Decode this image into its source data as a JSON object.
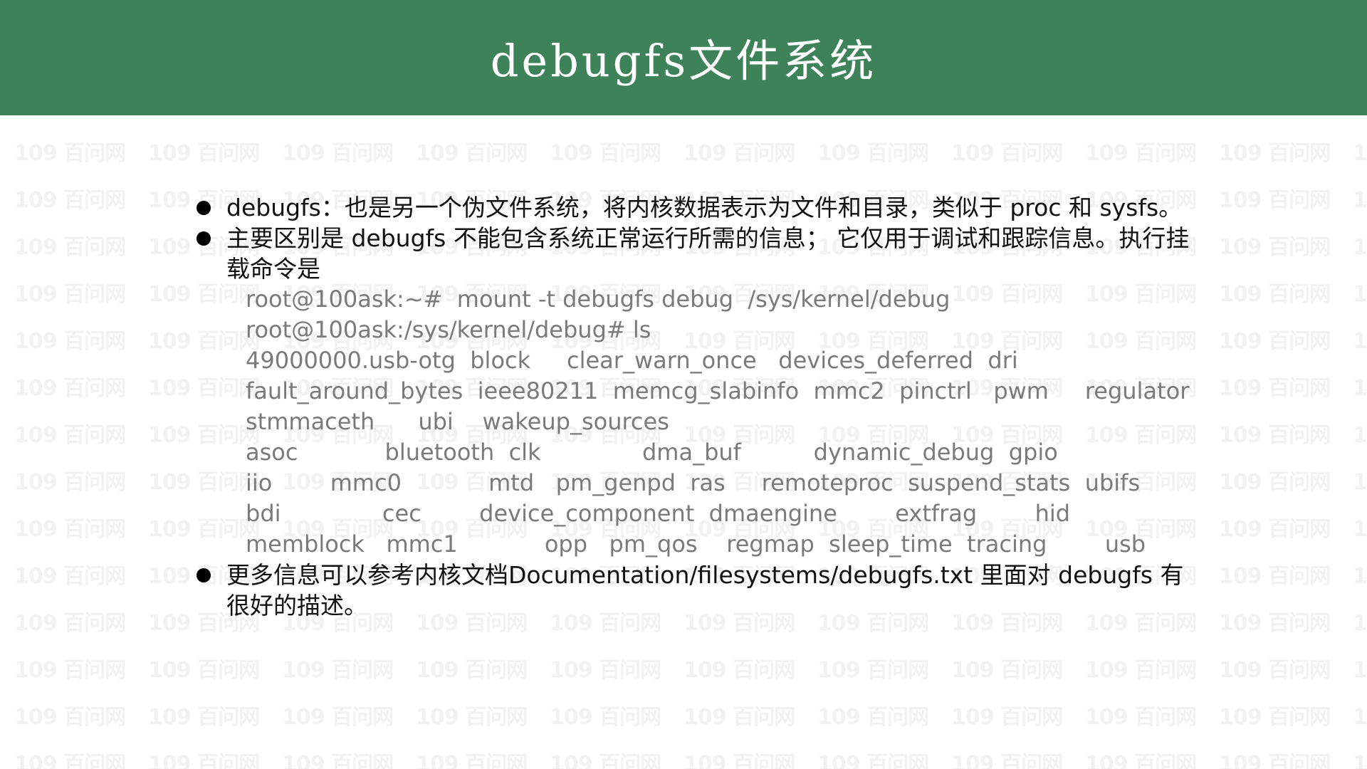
{
  "header": {
    "title": "debugfs文件系统",
    "background_color": "#3d8259"
  },
  "watermark": {
    "text": "109 百问网"
  },
  "bullets": [
    {
      "text": "debugfs：也是另一个伪文件系统，将内核数据表示为文件和目录，类似于 proc 和 sysfs。"
    },
    {
      "text": "主要区别是 debugfs 不能包含系统正常运行所需的信息；  它仅用于调试和跟踪信息。执行挂载命令是"
    },
    {
      "text": "更多信息可以参考内核文档Documentation/filesystems/debugfs.txt 里面对 debugfs 有很好的描述。"
    }
  ],
  "terminal": {
    "lines": [
      "root@100ask:~#  mount -t debugfs debug  /sys/kernel/debug",
      "root@100ask:/sys/kernel/debug# ls",
      "49000000.usb-otg  block     clear_warn_once   devices_deferred  dri",
      "fault_around_bytes  ieee80211  memcg_slabinfo  mmc2  pinctrl   pwm     regulator",
      "stmmaceth      ubi    wakeup_sources",
      "asoc            bluetooth  clk              dma_buf          dynamic_debug  gpio",
      "iio        mmc0            mtd   pm_genpd  ras     remoteproc  suspend_stats  ubifs",
      "bdi              cec        device_component  dmaengine        extfrag        hid",
      "memblock   mmc1            opp   pm_qos    regmap  sleep_time  tracing        usb"
    ],
    "text_color": "#7a7a7a"
  }
}
